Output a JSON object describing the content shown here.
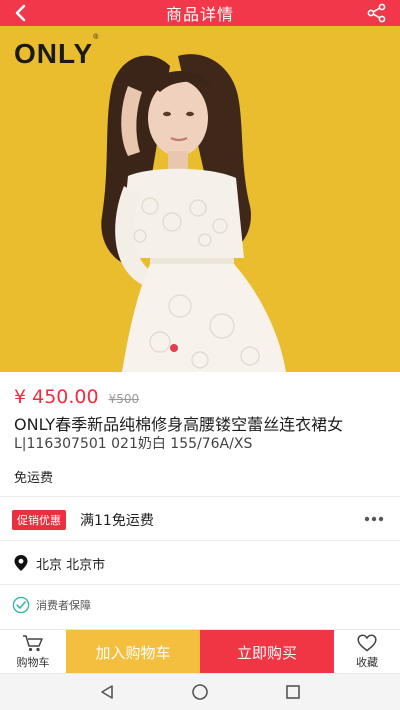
{
  "header": {
    "title": "商品详情",
    "back_icon": "chevron-left-icon",
    "share_icon": "share-icon"
  },
  "hero": {
    "brand_logo": "ONLY",
    "brand_mark": "®",
    "carousel_pages": 1,
    "carousel_active": 1
  },
  "product": {
    "price": "¥ 450.00",
    "original_price": "¥500",
    "title": "ONLY春季新品纯棉修身高腰镂空蕾丝连衣裙女",
    "sku": "L|116307501 021奶白 155/76A/XS",
    "shipping": "免运费"
  },
  "promo": {
    "badge": "促销优惠",
    "text": "满11免运费",
    "more_icon": "more-dots-icon"
  },
  "location": {
    "icon": "map-pin-icon",
    "text": "北京 北京市"
  },
  "guarantee": {
    "icon": "check-circle-icon",
    "text": "消费者保障"
  },
  "bottom_bar": {
    "cart_label": "购物车",
    "add_to_cart": "加入购物车",
    "buy_now": "立即购买",
    "favorite_label": "收藏"
  },
  "system_nav": {
    "back_icon": "triangle-back-icon",
    "home_icon": "circle-home-icon",
    "recents_icon": "square-recents-icon"
  },
  "colors": {
    "accent_red": "#f2374a",
    "promo_yellow": "#f4bf3f",
    "hero_yellow": "#e9bd2d"
  }
}
